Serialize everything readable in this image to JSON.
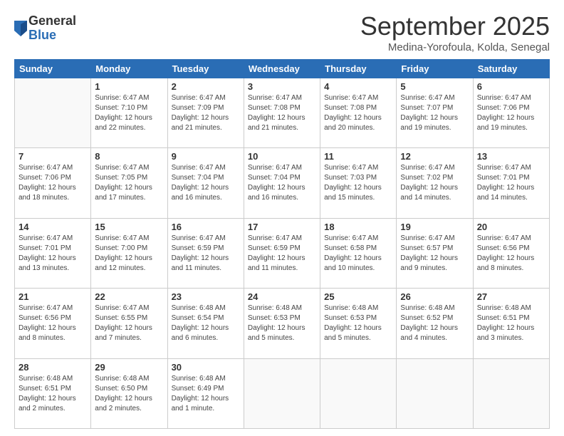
{
  "logo": {
    "general": "General",
    "blue": "Blue"
  },
  "header": {
    "month": "September 2025",
    "location": "Medina-Yorofoula, Kolda, Senegal"
  },
  "weekdays": [
    "Sunday",
    "Monday",
    "Tuesday",
    "Wednesday",
    "Thursday",
    "Friday",
    "Saturday"
  ],
  "weeks": [
    [
      {
        "day": "",
        "info": ""
      },
      {
        "day": "1",
        "info": "Sunrise: 6:47 AM\nSunset: 7:10 PM\nDaylight: 12 hours\nand 22 minutes."
      },
      {
        "day": "2",
        "info": "Sunrise: 6:47 AM\nSunset: 7:09 PM\nDaylight: 12 hours\nand 21 minutes."
      },
      {
        "day": "3",
        "info": "Sunrise: 6:47 AM\nSunset: 7:08 PM\nDaylight: 12 hours\nand 21 minutes."
      },
      {
        "day": "4",
        "info": "Sunrise: 6:47 AM\nSunset: 7:08 PM\nDaylight: 12 hours\nand 20 minutes."
      },
      {
        "day": "5",
        "info": "Sunrise: 6:47 AM\nSunset: 7:07 PM\nDaylight: 12 hours\nand 19 minutes."
      },
      {
        "day": "6",
        "info": "Sunrise: 6:47 AM\nSunset: 7:06 PM\nDaylight: 12 hours\nand 19 minutes."
      }
    ],
    [
      {
        "day": "7",
        "info": "Sunrise: 6:47 AM\nSunset: 7:06 PM\nDaylight: 12 hours\nand 18 minutes."
      },
      {
        "day": "8",
        "info": "Sunrise: 6:47 AM\nSunset: 7:05 PM\nDaylight: 12 hours\nand 17 minutes."
      },
      {
        "day": "9",
        "info": "Sunrise: 6:47 AM\nSunset: 7:04 PM\nDaylight: 12 hours\nand 16 minutes."
      },
      {
        "day": "10",
        "info": "Sunrise: 6:47 AM\nSunset: 7:04 PM\nDaylight: 12 hours\nand 16 minutes."
      },
      {
        "day": "11",
        "info": "Sunrise: 6:47 AM\nSunset: 7:03 PM\nDaylight: 12 hours\nand 15 minutes."
      },
      {
        "day": "12",
        "info": "Sunrise: 6:47 AM\nSunset: 7:02 PM\nDaylight: 12 hours\nand 14 minutes."
      },
      {
        "day": "13",
        "info": "Sunrise: 6:47 AM\nSunset: 7:01 PM\nDaylight: 12 hours\nand 14 minutes."
      }
    ],
    [
      {
        "day": "14",
        "info": "Sunrise: 6:47 AM\nSunset: 7:01 PM\nDaylight: 12 hours\nand 13 minutes."
      },
      {
        "day": "15",
        "info": "Sunrise: 6:47 AM\nSunset: 7:00 PM\nDaylight: 12 hours\nand 12 minutes."
      },
      {
        "day": "16",
        "info": "Sunrise: 6:47 AM\nSunset: 6:59 PM\nDaylight: 12 hours\nand 11 minutes."
      },
      {
        "day": "17",
        "info": "Sunrise: 6:47 AM\nSunset: 6:59 PM\nDaylight: 12 hours\nand 11 minutes."
      },
      {
        "day": "18",
        "info": "Sunrise: 6:47 AM\nSunset: 6:58 PM\nDaylight: 12 hours\nand 10 minutes."
      },
      {
        "day": "19",
        "info": "Sunrise: 6:47 AM\nSunset: 6:57 PM\nDaylight: 12 hours\nand 9 minutes."
      },
      {
        "day": "20",
        "info": "Sunrise: 6:47 AM\nSunset: 6:56 PM\nDaylight: 12 hours\nand 8 minutes."
      }
    ],
    [
      {
        "day": "21",
        "info": "Sunrise: 6:47 AM\nSunset: 6:56 PM\nDaylight: 12 hours\nand 8 minutes."
      },
      {
        "day": "22",
        "info": "Sunrise: 6:47 AM\nSunset: 6:55 PM\nDaylight: 12 hours\nand 7 minutes."
      },
      {
        "day": "23",
        "info": "Sunrise: 6:48 AM\nSunset: 6:54 PM\nDaylight: 12 hours\nand 6 minutes."
      },
      {
        "day": "24",
        "info": "Sunrise: 6:48 AM\nSunset: 6:53 PM\nDaylight: 12 hours\nand 5 minutes."
      },
      {
        "day": "25",
        "info": "Sunrise: 6:48 AM\nSunset: 6:53 PM\nDaylight: 12 hours\nand 5 minutes."
      },
      {
        "day": "26",
        "info": "Sunrise: 6:48 AM\nSunset: 6:52 PM\nDaylight: 12 hours\nand 4 minutes."
      },
      {
        "day": "27",
        "info": "Sunrise: 6:48 AM\nSunset: 6:51 PM\nDaylight: 12 hours\nand 3 minutes."
      }
    ],
    [
      {
        "day": "28",
        "info": "Sunrise: 6:48 AM\nSunset: 6:51 PM\nDaylight: 12 hours\nand 2 minutes."
      },
      {
        "day": "29",
        "info": "Sunrise: 6:48 AM\nSunset: 6:50 PM\nDaylight: 12 hours\nand 2 minutes."
      },
      {
        "day": "30",
        "info": "Sunrise: 6:48 AM\nSunset: 6:49 PM\nDaylight: 12 hours\nand 1 minute."
      },
      {
        "day": "",
        "info": ""
      },
      {
        "day": "",
        "info": ""
      },
      {
        "day": "",
        "info": ""
      },
      {
        "day": "",
        "info": ""
      }
    ]
  ]
}
